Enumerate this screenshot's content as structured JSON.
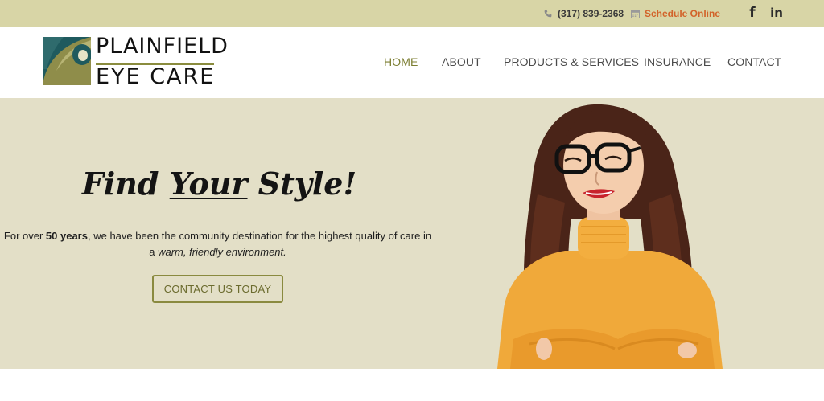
{
  "topbar": {
    "phone": "(317) 839-2368",
    "schedule_label": "Schedule Online",
    "facebook_glyph": "f",
    "linkedin_glyph": "in",
    "background": "#d8d5a6",
    "accent": "#d2632a"
  },
  "logo": {
    "line1": "PLAINFIELD",
    "line2": "EYE CARE"
  },
  "nav": {
    "items": [
      {
        "label": "HOME",
        "active": true
      },
      {
        "label": "ABOUT",
        "active": false
      },
      {
        "label": "PRODUCTS & SERVICES",
        "active": false
      },
      {
        "label": "INSURANCE",
        "active": false
      },
      {
        "label": "CONTACT",
        "active": false
      }
    ],
    "active_color": "#7c7e32"
  },
  "hero": {
    "headline_pre": "Find ",
    "headline_emph": "Your",
    "headline_post": " Style!",
    "intro_part1": "For over ",
    "intro_bold": "50 years",
    "intro_part2": ", we have been the community destination for the highest quality of care in a ",
    "intro_italic": "warm, friendly environment.",
    "cta_label": "CONTACT US TODAY",
    "background": "#e3dfc7"
  },
  "icons": {
    "phone": "phone-icon",
    "calendar": "calendar-icon",
    "facebook": "facebook-icon",
    "linkedin": "linkedin-icon"
  }
}
